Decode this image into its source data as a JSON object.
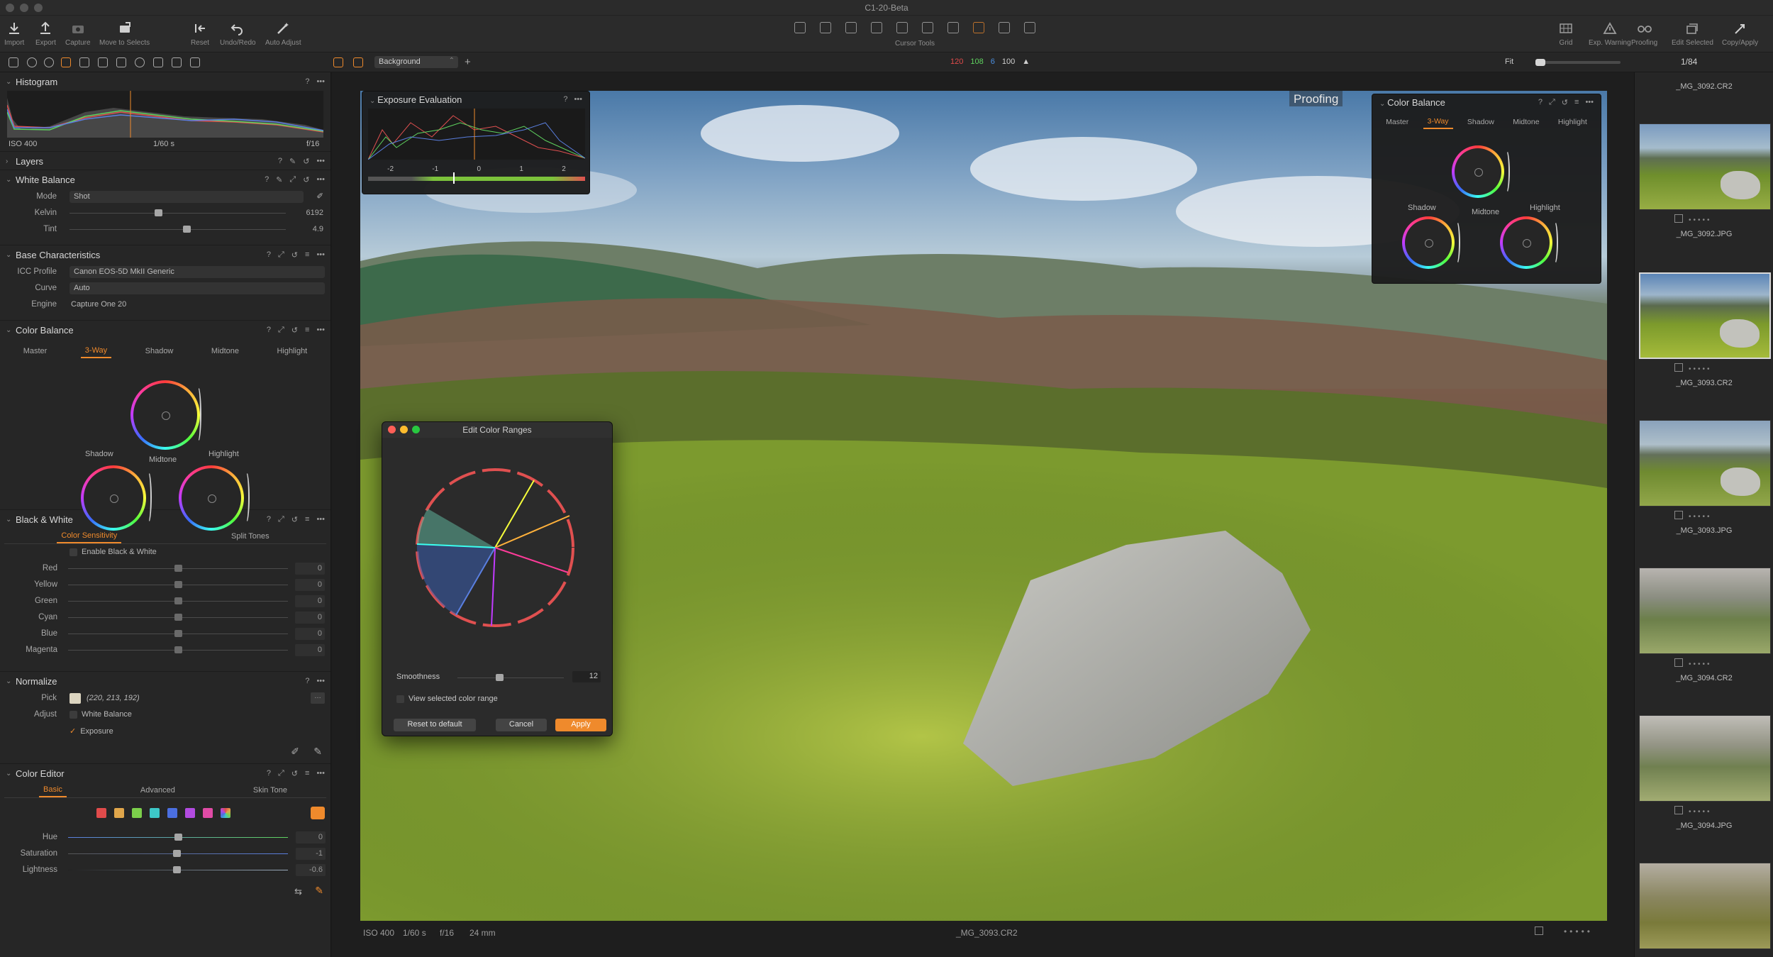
{
  "window": {
    "title": "C1-20-Beta"
  },
  "toolbar": {
    "left": [
      "Import",
      "Export",
      "Capture",
      "Move to Selects"
    ],
    "middle": [
      "Reset",
      "Undo/Redo",
      "Auto Adjust"
    ],
    "cursor_tools_label": "Cursor Tools",
    "right": [
      "Grid",
      "Exp. Warning",
      "Proofing",
      "Edit Selected",
      "Copy/Apply"
    ]
  },
  "subbar": {
    "background_select": "Background",
    "readout": {
      "r": "120",
      "g": "108",
      "b": "6",
      "l": "100"
    },
    "zoom_label": "Fit",
    "counter": "1/84"
  },
  "histogram": {
    "title": "Histogram",
    "iso": "ISO 400",
    "shutter": "1/60 s",
    "aperture": "f/16"
  },
  "layers": {
    "title": "Layers"
  },
  "white_balance": {
    "title": "White Balance",
    "mode_label": "Mode",
    "mode_value": "Shot",
    "kelvin_label": "Kelvin",
    "kelvin_value": "6192",
    "tint_label": "Tint",
    "tint_value": "4.9"
  },
  "base_characteristics": {
    "title": "Base Characteristics",
    "icc_label": "ICC Profile",
    "icc_value": "Canon EOS-5D MkII Generic",
    "curve_label": "Curve",
    "curve_value": "Auto",
    "engine_label": "Engine",
    "engine_value": "Capture One 20"
  },
  "color_balance": {
    "title": "Color Balance",
    "tabs": [
      "Master",
      "3-Way",
      "Shadow",
      "Midtone",
      "Highlight"
    ],
    "shadow_label": "Shadow",
    "midtone_label": "Midtone",
    "highlight_label": "Highlight"
  },
  "black_white": {
    "title": "Black & White",
    "tabs": [
      "Color Sensitivity",
      "Split Tones"
    ],
    "enable_label": "Enable Black & White",
    "channels": [
      {
        "label": "Red",
        "value": "0"
      },
      {
        "label": "Yellow",
        "value": "0"
      },
      {
        "label": "Green",
        "value": "0"
      },
      {
        "label": "Cyan",
        "value": "0"
      },
      {
        "label": "Blue",
        "value": "0"
      },
      {
        "label": "Magenta",
        "value": "0"
      }
    ]
  },
  "normalize": {
    "title": "Normalize",
    "pick_label": "Pick",
    "pick_value": "(220, 213, 192)",
    "adjust_label": "Adjust",
    "white_balance_label": "White Balance",
    "exposure_label": "Exposure"
  },
  "color_editor": {
    "title": "Color Editor",
    "tabs": [
      "Basic",
      "Advanced",
      "Skin Tone"
    ],
    "swatches": [
      "#e04b4b",
      "#e0a64b",
      "#7ccf4b",
      "#3dc7c7",
      "#4b6fe0",
      "#b24be0",
      "#e04ba6"
    ],
    "hue_label": "Hue",
    "hue_value": "0",
    "saturation_label": "Saturation",
    "saturation_value": "-1",
    "lightness_label": "Lightness",
    "lightness_value": "-0.6"
  },
  "viewer": {
    "proofing_label": "Proofing",
    "status": {
      "iso": "ISO 400",
      "shutter": "1/60 s",
      "aperture": "f/16",
      "focal": "24 mm",
      "filename": "_MG_3093.CR2"
    }
  },
  "exposure_eval": {
    "title": "Exposure Evaluation",
    "scale": [
      "-2",
      "-1",
      "0",
      "1",
      "2"
    ]
  },
  "float_color_balance": {
    "title": "Color Balance",
    "tabs": [
      "Master",
      "3-Way",
      "Shadow",
      "Midtone",
      "Highlight"
    ],
    "shadow_label": "Shadow",
    "midtone_label": "Midtone",
    "highlight_label": "Highlight"
  },
  "edit_color_ranges": {
    "title": "Edit Color Ranges",
    "smoothness_label": "Smoothness",
    "smoothness_value": "12",
    "view_label": "View selected color range",
    "reset_label": "Reset to default",
    "cancel_label": "Cancel",
    "apply_label": "Apply"
  },
  "filmstrip": [
    {
      "name": "_MG_3092.CR2"
    },
    {
      "name": "_MG_3092.JPG"
    },
    {
      "name": "_MG_3093.CR2"
    },
    {
      "name": "_MG_3093.JPG"
    },
    {
      "name": "_MG_3094.CR2"
    },
    {
      "name": "_MG_3094.JPG"
    }
  ],
  "colors": {
    "accent": "#ef8a2c",
    "panel": "#262626"
  }
}
